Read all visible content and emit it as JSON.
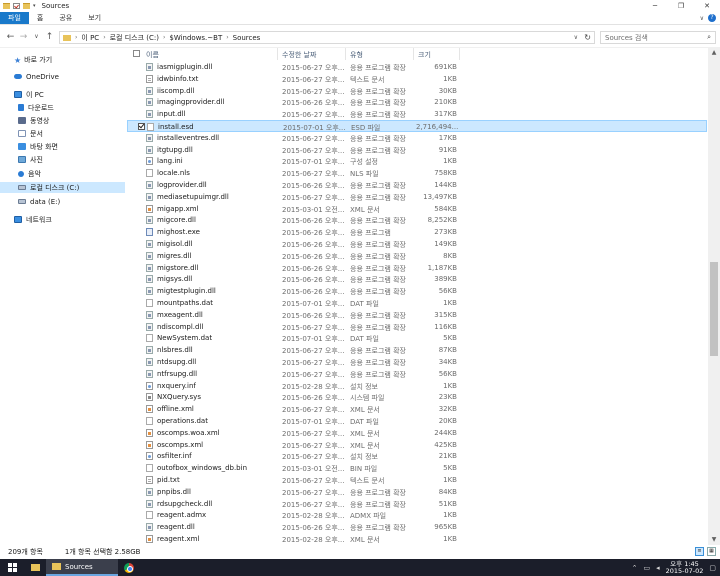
{
  "window": {
    "title": "Sources",
    "minimize": "─",
    "maximize": "❐",
    "close": "✕"
  },
  "ribbon": {
    "tabs": [
      "파일",
      "홈",
      "공유",
      "보기"
    ],
    "expand": "∨",
    "help": "?"
  },
  "nav": {
    "back": "←",
    "forward": "→",
    "recent": "∨",
    "up": "↑"
  },
  "address": {
    "segments": [
      "이 PC",
      "로컬 디스크 (C:)",
      "$Windows.~BT",
      "Sources"
    ],
    "refresh": "↻",
    "dropdown": "∨"
  },
  "search": {
    "placeholder": "Sources 검색"
  },
  "sidebar": {
    "items": [
      {
        "label": "바로 가기",
        "icon": "star-icon"
      },
      {
        "label": "OneDrive",
        "icon": "cloud-icon"
      },
      {
        "label": "이 PC",
        "icon": "pc-icon"
      },
      {
        "label": "다운로드",
        "icon": "download-icon"
      },
      {
        "label": "동영상",
        "icon": "video-icon"
      },
      {
        "label": "문서",
        "icon": "document-icon"
      },
      {
        "label": "바탕 화면",
        "icon": "desktop-icon"
      },
      {
        "label": "사진",
        "icon": "picture-icon"
      },
      {
        "label": "음악",
        "icon": "music-icon"
      },
      {
        "label": "로컬 디스크 (C:)",
        "icon": "drive-icon"
      },
      {
        "label": "data (E:)",
        "icon": "drive-icon"
      },
      {
        "label": "네트워크",
        "icon": "network-icon"
      }
    ]
  },
  "columns": {
    "name": "이름",
    "date": "수정한 날짜",
    "type": "유형",
    "size": "크기"
  },
  "files": [
    {
      "name": "iasmigplugin.dll",
      "date": "2015-06-27 오후...",
      "type": "응용 프로그램 확장",
      "size": "691KB",
      "icon": "dll"
    },
    {
      "name": "idwbinfo.txt",
      "date": "2015-06-27 오후...",
      "type": "텍스트 문서",
      "size": "1KB",
      "icon": "txt"
    },
    {
      "name": "iiscomp.dll",
      "date": "2015-06-27 오후...",
      "type": "응용 프로그램 확장",
      "size": "30KB",
      "icon": "dll"
    },
    {
      "name": "imagingprovider.dll",
      "date": "2015-06-26 오후...",
      "type": "응용 프로그램 확장",
      "size": "210KB",
      "icon": "dll"
    },
    {
      "name": "input.dll",
      "date": "2015-06-27 오후...",
      "type": "응용 프로그램 확장",
      "size": "317KB",
      "icon": "dll"
    },
    {
      "name": "install.esd",
      "date": "2015-07-01 오후...",
      "type": "ESD 파일",
      "size": "2,716,494...",
      "icon": "gen",
      "selected": true
    },
    {
      "name": "installeventres.dll",
      "date": "2015-06-27 오후...",
      "type": "응용 프로그램 확장",
      "size": "17KB",
      "icon": "dll"
    },
    {
      "name": "itgtupg.dll",
      "date": "2015-06-27 오후...",
      "type": "응용 프로그램 확장",
      "size": "91KB",
      "icon": "dll"
    },
    {
      "name": "lang.ini",
      "date": "2015-07-01 오후...",
      "type": "구성 설정",
      "size": "1KB",
      "icon": "ini"
    },
    {
      "name": "locale.nls",
      "date": "2015-06-27 오후...",
      "type": "NLS 파일",
      "size": "758KB",
      "icon": "gen"
    },
    {
      "name": "logprovider.dll",
      "date": "2015-06-26 오후...",
      "type": "응용 프로그램 확장",
      "size": "144KB",
      "icon": "dll"
    },
    {
      "name": "mediasetupuimgr.dll",
      "date": "2015-06-27 오후...",
      "type": "응용 프로그램 확장",
      "size": "13,497KB",
      "icon": "dll"
    },
    {
      "name": "migapp.xml",
      "date": "2015-03-01 오전...",
      "type": "XML 문서",
      "size": "584KB",
      "icon": "xml"
    },
    {
      "name": "migcore.dll",
      "date": "2015-06-26 오후...",
      "type": "응용 프로그램 확장",
      "size": "8,252KB",
      "icon": "dll"
    },
    {
      "name": "mighost.exe",
      "date": "2015-06-26 오후...",
      "type": "응용 프로그램",
      "size": "273KB",
      "icon": "exe"
    },
    {
      "name": "migisol.dll",
      "date": "2015-06-26 오후...",
      "type": "응용 프로그램 확장",
      "size": "149KB",
      "icon": "dll"
    },
    {
      "name": "migres.dll",
      "date": "2015-06-26 오후...",
      "type": "응용 프로그램 확장",
      "size": "8KB",
      "icon": "dll"
    },
    {
      "name": "migstore.dll",
      "date": "2015-06-26 오후...",
      "type": "응용 프로그램 확장",
      "size": "1,187KB",
      "icon": "dll"
    },
    {
      "name": "migsys.dll",
      "date": "2015-06-26 오후...",
      "type": "응용 프로그램 확장",
      "size": "389KB",
      "icon": "dll"
    },
    {
      "name": "migtestplugin.dll",
      "date": "2015-06-26 오후...",
      "type": "응용 프로그램 확장",
      "size": "56KB",
      "icon": "dll"
    },
    {
      "name": "mountpaths.dat",
      "date": "2015-07-01 오후...",
      "type": "DAT 파일",
      "size": "1KB",
      "icon": "gen"
    },
    {
      "name": "mxeagent.dll",
      "date": "2015-06-26 오후...",
      "type": "응용 프로그램 확장",
      "size": "315KB",
      "icon": "dll"
    },
    {
      "name": "ndiscompl.dll",
      "date": "2015-06-27 오후...",
      "type": "응용 프로그램 확장",
      "size": "116KB",
      "icon": "dll"
    },
    {
      "name": "NewSystem.dat",
      "date": "2015-07-01 오후...",
      "type": "DAT 파일",
      "size": "5KB",
      "icon": "gen"
    },
    {
      "name": "nlsbres.dll",
      "date": "2015-06-27 오후...",
      "type": "응용 프로그램 확장",
      "size": "87KB",
      "icon": "dll"
    },
    {
      "name": "ntdsupg.dll",
      "date": "2015-06-27 오후...",
      "type": "응용 프로그램 확장",
      "size": "34KB",
      "icon": "dll"
    },
    {
      "name": "ntfrsupg.dll",
      "date": "2015-06-27 오후...",
      "type": "응용 프로그램 확장",
      "size": "56KB",
      "icon": "dll"
    },
    {
      "name": "nxquery.inf",
      "date": "2015-02-28 오후...",
      "type": "설치 정보",
      "size": "1KB",
      "icon": "ini"
    },
    {
      "name": "NXQuery.sys",
      "date": "2015-06-26 오후...",
      "type": "시스템 파일",
      "size": "23KB",
      "icon": "sys"
    },
    {
      "name": "offline.xml",
      "date": "2015-06-27 오후...",
      "type": "XML 문서",
      "size": "32KB",
      "icon": "xml"
    },
    {
      "name": "operations.dat",
      "date": "2015-07-01 오후...",
      "type": "DAT 파일",
      "size": "20KB",
      "icon": "gen"
    },
    {
      "name": "oscomps.woa.xml",
      "date": "2015-06-27 오후...",
      "type": "XML 문서",
      "size": "244KB",
      "icon": "xml"
    },
    {
      "name": "oscomps.xml",
      "date": "2015-06-27 오후...",
      "type": "XML 문서",
      "size": "425KB",
      "icon": "xml"
    },
    {
      "name": "osfilter.inf",
      "date": "2015-06-27 오후...",
      "type": "설치 정보",
      "size": "21KB",
      "icon": "ini"
    },
    {
      "name": "outofbox_windows_db.bin",
      "date": "2015-03-01 오전...",
      "type": "BIN 파일",
      "size": "5KB",
      "icon": "gen"
    },
    {
      "name": "pid.txt",
      "date": "2015-06-27 오후...",
      "type": "텍스트 문서",
      "size": "1KB",
      "icon": "txt"
    },
    {
      "name": "pnpibs.dll",
      "date": "2015-06-27 오후...",
      "type": "응용 프로그램 확장",
      "size": "84KB",
      "icon": "dll"
    },
    {
      "name": "rdsupgcheck.dll",
      "date": "2015-06-27 오후...",
      "type": "응용 프로그램 확장",
      "size": "51KB",
      "icon": "dll"
    },
    {
      "name": "reagent.admx",
      "date": "2015-02-28 오후...",
      "type": "ADMX 파일",
      "size": "1KB",
      "icon": "gen"
    },
    {
      "name": "reagent.dll",
      "date": "2015-06-26 오후...",
      "type": "응용 프로그램 확장",
      "size": "965KB",
      "icon": "dll"
    },
    {
      "name": "reagent.xml",
      "date": "2015-02-28 오후...",
      "type": "XML 문서",
      "size": "1KB",
      "icon": "xml"
    }
  ],
  "status": {
    "count": "209개 항목",
    "selection": "1개 항목 선택함 2.58GB"
  },
  "taskbar": {
    "explorer_label": "Sources",
    "time": "오후 1:45",
    "date": "2015-07-02",
    "accent": "#1979ca"
  }
}
